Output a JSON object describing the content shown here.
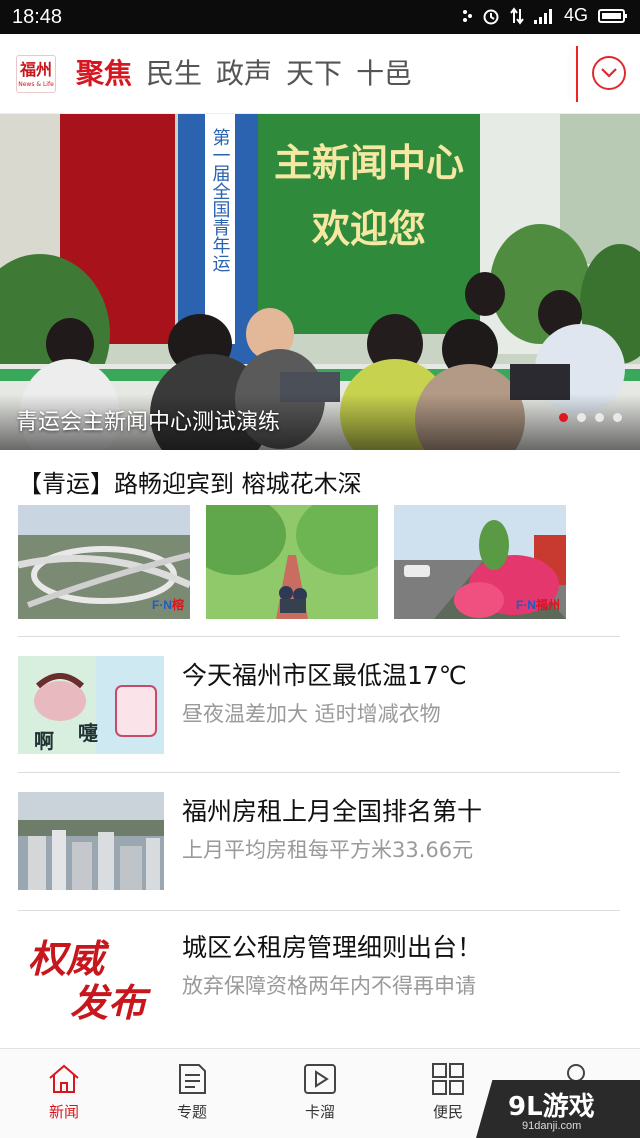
{
  "status_bar": {
    "time": "18:48",
    "network": "4G",
    "alarm_icon": "alarm-icon",
    "signal_icon": "signal-icon",
    "battery_icon": "battery-icon"
  },
  "header": {
    "logo_text": "福州",
    "logo_sub": "News & Life",
    "tabs": [
      {
        "label": "聚焦",
        "active": true
      },
      {
        "label": "民生",
        "active": false
      },
      {
        "label": "政声",
        "active": false
      },
      {
        "label": "天下",
        "active": false
      },
      {
        "label": "十邑",
        "active": false
      }
    ],
    "accent_color": "#d8161f"
  },
  "banner": {
    "caption": "青运会主新闻中心测试演练",
    "sign_line1": "主新闻中心",
    "sign_line2": "欢迎您",
    "side_banner": "第一届全国青年运",
    "slide_count": 4,
    "active_slide": 1
  },
  "feature": {
    "title": "【青运】路畅迎宾到 榕城花木深",
    "watermark": "F·N 福州新闻"
  },
  "news": [
    {
      "title": "今天福州市区最低温17℃",
      "subtitle": "昼夜温差加大 适时增减衣物",
      "img_text1": "啊",
      "img_text2": "嚏"
    },
    {
      "title": "福州房租上月全国排名第十",
      "subtitle": "上月平均房租每平方米33.66元"
    },
    {
      "title": "城区公租房管理细则出台！",
      "subtitle": "放弃保障资格两年内不得再申请",
      "img_text1": "权威",
      "img_text2": "发布"
    }
  ],
  "bottom_nav": [
    {
      "label": "新闻",
      "icon": "home-icon",
      "active": true
    },
    {
      "label": "专题",
      "icon": "document-icon",
      "active": false
    },
    {
      "label": "卡溜",
      "icon": "video-play-icon",
      "active": false
    },
    {
      "label": "便民",
      "icon": "grid-icon",
      "active": false
    },
    {
      "label": "",
      "icon": "profile-icon",
      "active": false
    }
  ],
  "watermark": {
    "main": "9L游戏",
    "sub": "91danji.com"
  }
}
